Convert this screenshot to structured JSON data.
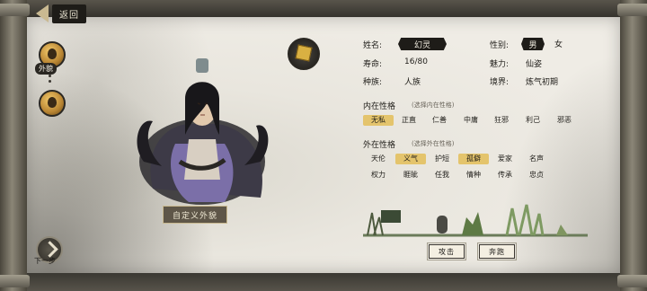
{
  "header": {
    "back_label": "返回"
  },
  "sidebar": {
    "appearance_label": "外貌",
    "next_label": "下一步"
  },
  "character": {
    "custom_label": "自定义外貌"
  },
  "info": {
    "name_label": "姓名:",
    "name_value": "幻灵",
    "gender_label": "性别:",
    "gender_male": "男",
    "gender_female": "女",
    "lifespan_label": "寿命:",
    "lifespan_value": "16/80",
    "charm_label": "魅力:",
    "charm_value": "仙姿",
    "race_label": "种族:",
    "race_value": "人族",
    "realm_label": "境界:",
    "realm_value": "炼气初期"
  },
  "inner": {
    "title": "内在性格",
    "hint": "(选择内在性格)",
    "traits": [
      "无私",
      "正直",
      "仁善",
      "中庸",
      "狂邪",
      "利己",
      "邪恶"
    ],
    "selected": "无私"
  },
  "outer": {
    "title": "外在性格",
    "hint": "(选择外在性格)",
    "row1": [
      "天伦",
      "义气",
      "护短",
      "孤僻",
      "爱家",
      "名声"
    ],
    "row2": [
      "权力",
      "睚眦",
      "任我",
      "情种",
      "传承",
      "忠贞"
    ],
    "selected": [
      "义气",
      "孤僻"
    ]
  },
  "actions": {
    "attack_label": "攻击",
    "flee_label": "奔跑"
  },
  "colors": {
    "accent": "#e4c46c",
    "ink": "#1e1c18",
    "paper": "#ece9e1"
  }
}
